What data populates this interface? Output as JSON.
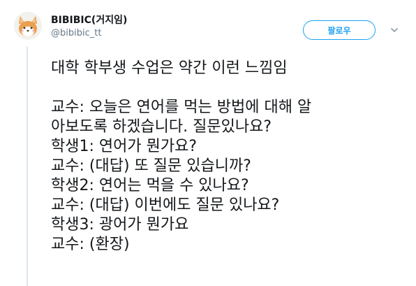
{
  "author": {
    "display_name": "BIBIBIC(거지임)",
    "handle": "@bibibic_tt",
    "avatar_icon": "shiba-dog-icon"
  },
  "actions": {
    "follow_label": "팔로우",
    "more_icon": "chevron-down-icon"
  },
  "tweet": {
    "lines": [
      "대학 학부생 수업은 약간 이런 느낌임",
      "",
      "교수: 오늘은 연어를 먹는 방법에 대해 알",
      "아보도록 하겠습니다. 질문있나요?",
      "학생1: 연어가 뭔가요?",
      "교수: (대답) 또 질문 있습니까?",
      "학생2: 연어는 먹을 수 있나요?",
      "교수: (대답) 이번에도 질문 있나요?",
      "학생3: 광어가 뭔가요",
      "교수: (환장)"
    ]
  },
  "colors": {
    "accent": "#1da1f2",
    "text": "#14171a",
    "muted": "#657786",
    "thread_line": "#dbe6ec"
  }
}
